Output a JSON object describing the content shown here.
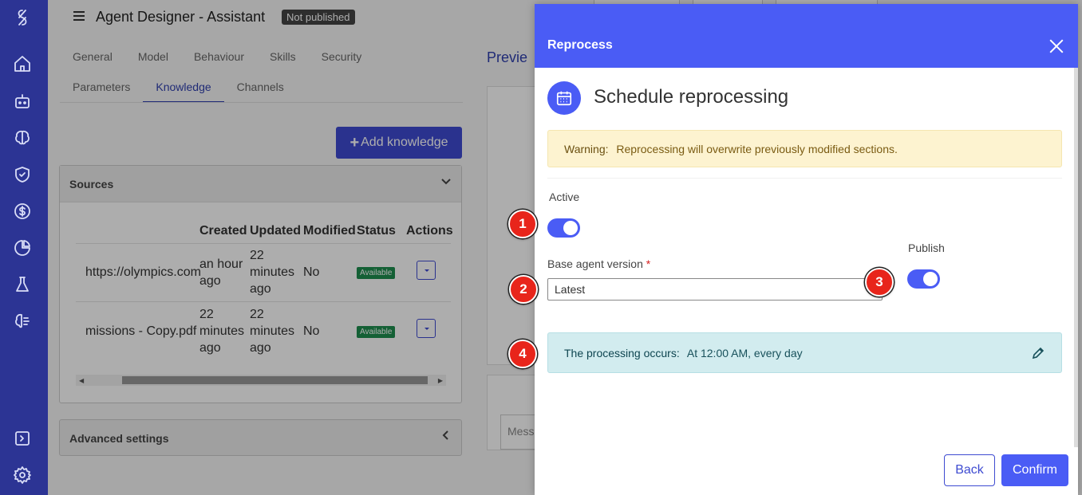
{
  "app": {
    "title": "Agent Designer - Assistant",
    "status_badge": "Not published",
    "tabs_row1": [
      "General",
      "Model",
      "Behaviour",
      "Skills",
      "Security"
    ],
    "tabs_row2": [
      "Parameters",
      "Knowledge",
      "Channels"
    ],
    "active_tab": "Knowledge",
    "add_knowledge_label": "Add knowledge",
    "preview_title": "Previe",
    "message_placeholder": "Messa"
  },
  "sources": {
    "title": "Sources",
    "columns": [
      "Created",
      "Updated",
      "Modified",
      "Status",
      "Actions"
    ],
    "rows": [
      {
        "name": "https://olympics.com",
        "created": [
          "an hour",
          "ago"
        ],
        "updated": [
          "22",
          "minutes",
          "ago"
        ],
        "modified": "No",
        "status": "Available"
      },
      {
        "name": "missions - Copy.pdf",
        "created": [
          "22",
          "minutes",
          "ago"
        ],
        "updated": [
          "22",
          "minutes",
          "ago"
        ],
        "modified": "No",
        "status": "Available"
      }
    ]
  },
  "advanced_settings": "Advanced settings",
  "dialog": {
    "title": "Reprocess",
    "heading": "Schedule reprocessing",
    "warning_label": "Warning:",
    "warning_text": "Reprocessing will overwrite previously modified sections.",
    "active_label": "Active",
    "active_on": true,
    "publish_label": "Publish",
    "publish_on": true,
    "base_version_label": "Base agent version",
    "required_mark": "*",
    "base_version_value": "Latest",
    "processing_label": "The processing occurs:",
    "processing_value": "At 12:00 AM, every day",
    "back_label": "Back",
    "confirm_label": "Confirm"
  },
  "markers": [
    "1",
    "2",
    "3",
    "4"
  ],
  "colors": {
    "rail": "#2c3494",
    "primary": "#4a5cf5",
    "marker": "#e8251b",
    "warning_bg": "#fdf3d0",
    "info_bg": "#d2ecef"
  },
  "icons": [
    "logo-icon",
    "home-icon",
    "robot-icon",
    "brain-icon",
    "shield-icon",
    "dollar-icon",
    "pie-chart-icon",
    "flask-icon",
    "ai-brain-icon",
    "expand-panel-icon",
    "settings-icon"
  ]
}
